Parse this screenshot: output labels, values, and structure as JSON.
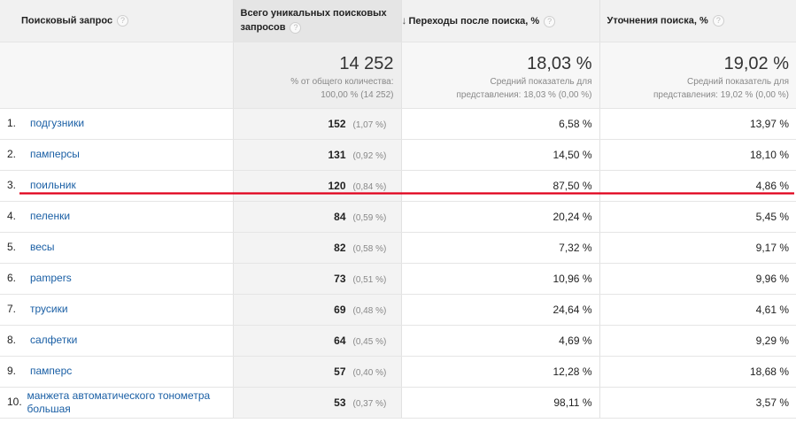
{
  "columns": {
    "query": "Поисковый запрос",
    "unique_searches": "Всего уникальных поисковых запросов",
    "exits_after": "Переходы после поиска, %",
    "refinements": "Уточнения поиска, %"
  },
  "summary": {
    "unique_total": "14 252",
    "unique_sub_1": "% от общего количества:",
    "unique_sub_2": "100,00 % (14 252)",
    "exits_total": "18,03 %",
    "exits_sub_1": "Средний показатель для",
    "exits_sub_2": "представления: 18,03 % (0,00 %)",
    "ref_total": "19,02 %",
    "ref_sub_1": "Средний показатель для",
    "ref_sub_2": "представления: 19,02 % (0,00 %)"
  },
  "rows": [
    {
      "idx": "1.",
      "query": "подгузники",
      "count": "152",
      "share": "(1,07 %)",
      "exits": "6,58 %",
      "ref": "13,97 %"
    },
    {
      "idx": "2.",
      "query": "памперсы",
      "count": "131",
      "share": "(0,92 %)",
      "exits": "14,50 %",
      "ref": "18,10 %"
    },
    {
      "idx": "3.",
      "query": "поильник",
      "count": "120",
      "share": "(0,84 %)",
      "exits": "87,50 %",
      "ref": "4,86 %"
    },
    {
      "idx": "4.",
      "query": "пеленки",
      "count": "84",
      "share": "(0,59 %)",
      "exits": "20,24 %",
      "ref": "5,45 %"
    },
    {
      "idx": "5.",
      "query": "весы",
      "count": "82",
      "share": "(0,58 %)",
      "exits": "7,32 %",
      "ref": "9,17 %"
    },
    {
      "idx": "6.",
      "query": "pampers",
      "count": "73",
      "share": "(0,51 %)",
      "exits": "10,96 %",
      "ref": "9,96 %"
    },
    {
      "idx": "7.",
      "query": "трусики",
      "count": "69",
      "share": "(0,48 %)",
      "exits": "24,64 %",
      "ref": "4,61 %"
    },
    {
      "idx": "8.",
      "query": "салфетки",
      "count": "64",
      "share": "(0,45 %)",
      "exits": "4,69 %",
      "ref": "9,29 %"
    },
    {
      "idx": "9.",
      "query": "памперс",
      "count": "57",
      "share": "(0,40 %)",
      "exits": "12,28 %",
      "ref": "18,68 %"
    },
    {
      "idx": "10.",
      "query": "манжета автоматического тонометра большая",
      "count": "53",
      "share": "(0,37 %)",
      "exits": "98,11 %",
      "ref": "3,57 %"
    }
  ],
  "icons": {
    "help": "?",
    "sort": "↓"
  },
  "colors": {
    "link": "#1a5fa5",
    "annotation": "#e0001b"
  }
}
